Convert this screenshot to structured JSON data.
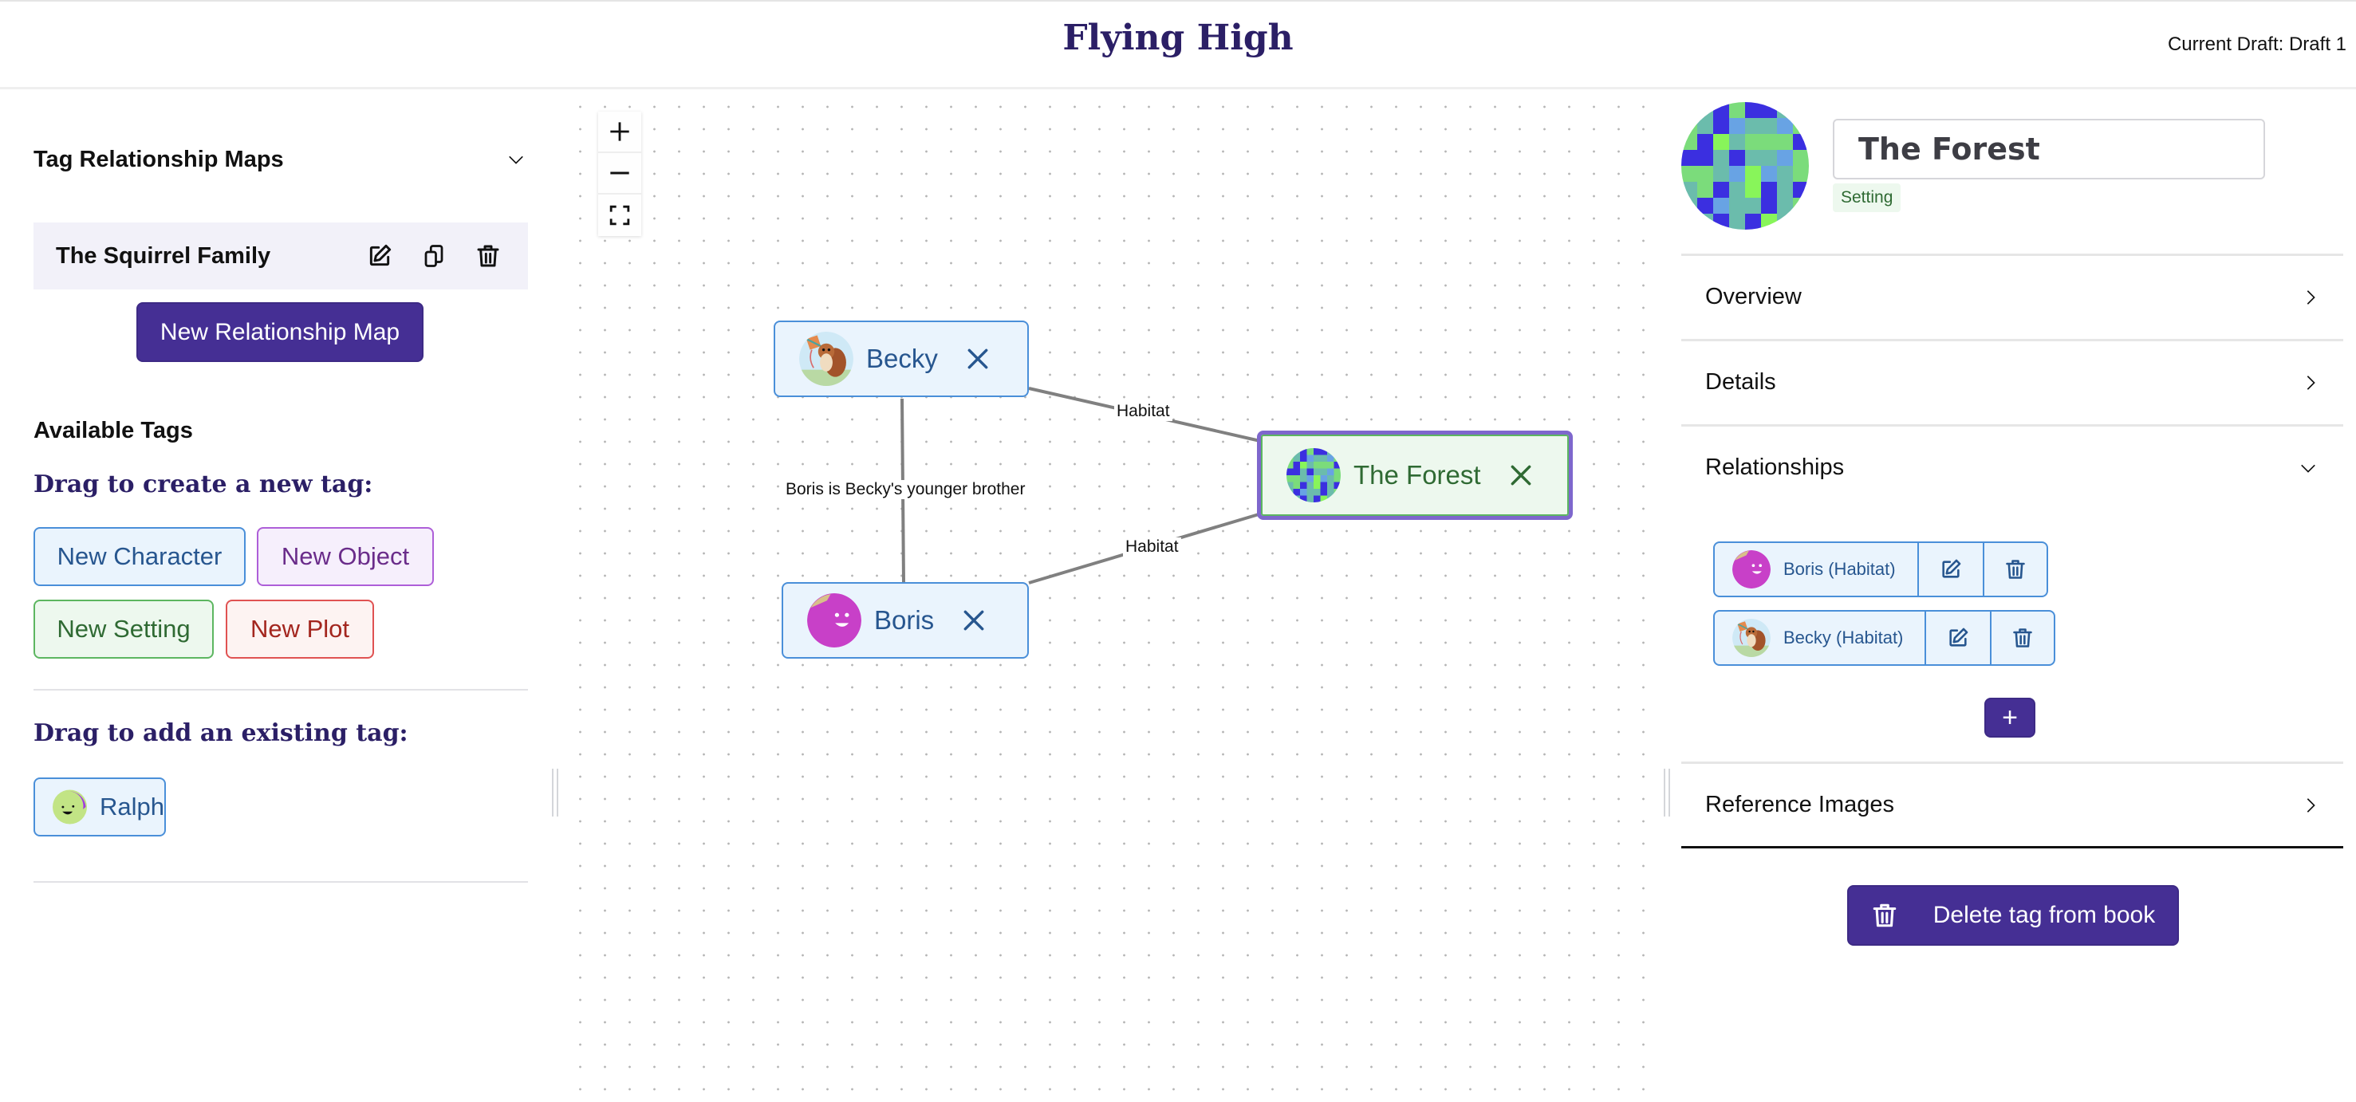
{
  "header": {
    "title": "Flying High",
    "current_draft": "Current Draft: Draft 1"
  },
  "sidebar": {
    "maps_section": {
      "label": "Tag Relationship Maps",
      "expanded": true,
      "maps": [
        {
          "name": "The Squirrel Family",
          "actions": [
            "edit-icon",
            "duplicate-icon",
            "trash-icon"
          ]
        }
      ],
      "new_map_button": "New Relationship Map"
    },
    "available_tags_label": "Available Tags",
    "create_new_heading": "Drag to create a new tag:",
    "new_tag_types": [
      {
        "label": "New Character",
        "type": "character"
      },
      {
        "label": "New Object",
        "type": "object"
      },
      {
        "label": "New Setting",
        "type": "setting"
      },
      {
        "label": "New Plot",
        "type": "plot"
      }
    ],
    "add_existing_heading": "Drag to add an existing tag:",
    "existing_tags": [
      {
        "name": "Ralph",
        "type": "character",
        "avatar": "green-smiley-avatar"
      }
    ]
  },
  "canvas": {
    "controls": [
      "zoom-in-icon",
      "zoom-out-icon",
      "fit-view-icon"
    ],
    "nodes": [
      {
        "id": "becky",
        "name": "Becky",
        "type": "character",
        "avatar": "squirrel-kite-avatar",
        "selected": false
      },
      {
        "id": "boris",
        "name": "Boris",
        "type": "character",
        "avatar": "magenta-smiley-avatar",
        "selected": false
      },
      {
        "id": "forest",
        "name": "The Forest",
        "type": "setting",
        "avatar": "pixel-grid-avatar",
        "selected": true
      }
    ],
    "edges": [
      {
        "from": "becky",
        "to": "forest",
        "label": "Habitat"
      },
      {
        "from": "boris",
        "to": "forest",
        "label": "Habitat"
      },
      {
        "from": "becky",
        "to": "boris",
        "label": "Boris is Becky's younger brother"
      }
    ]
  },
  "detail_panel": {
    "name_value": "The Forest",
    "type_badge": "Setting",
    "sections": [
      {
        "label": "Overview",
        "expanded": false
      },
      {
        "label": "Details",
        "expanded": false
      },
      {
        "label": "Relationships",
        "expanded": true
      },
      {
        "label": "Reference Images",
        "expanded": false
      }
    ],
    "relationships": [
      {
        "label": "Boris (Habitat)",
        "avatar": "magenta-smiley-avatar"
      },
      {
        "label": "Becky (Habitat)",
        "avatar": "squirrel-kite-avatar"
      }
    ],
    "add_relationship_label": "+",
    "delete_button": "Delete tag from book"
  },
  "colors": {
    "brand_purple": "#452f94",
    "title_navy": "#2b1f66",
    "character_blue": "#4a8fd9",
    "object_purple": "#ae5fd8",
    "setting_green": "#5cb660",
    "plot_red": "#e05252",
    "selection_outline": "#7e67cd"
  }
}
